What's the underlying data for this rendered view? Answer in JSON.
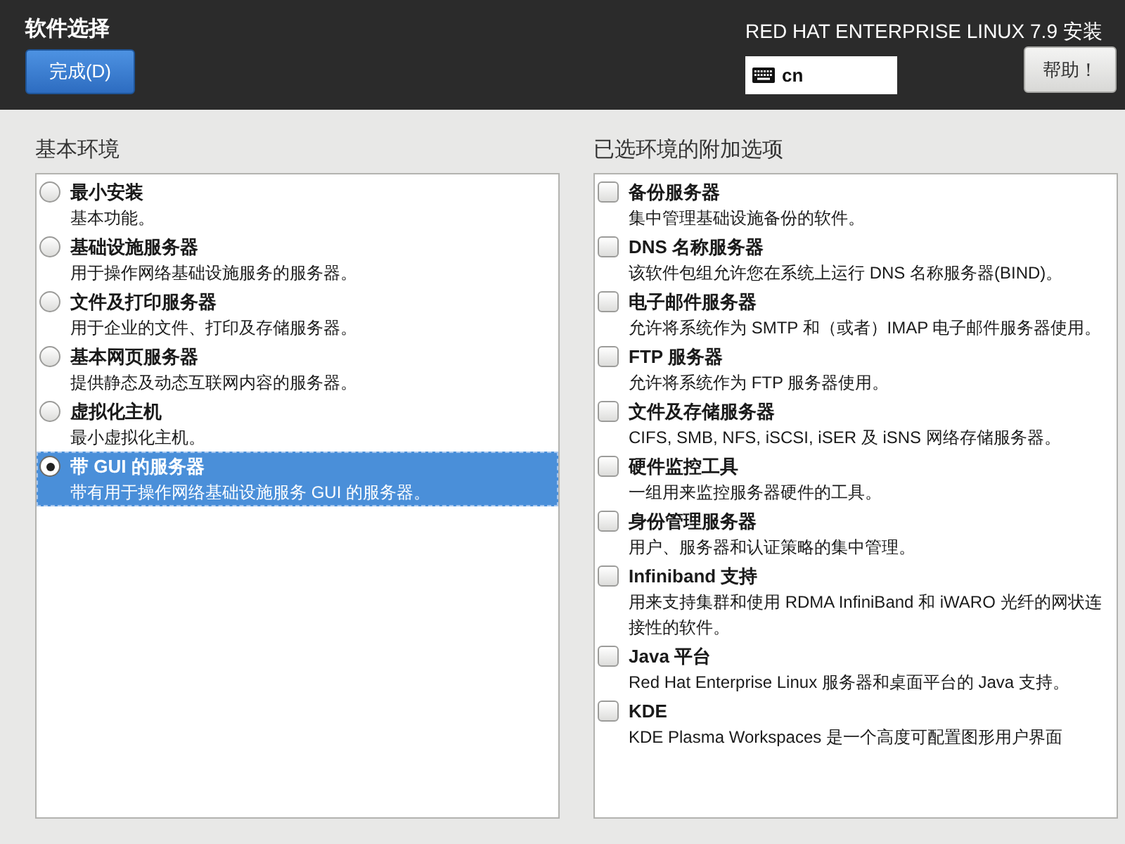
{
  "header": {
    "title": "软件选择",
    "done_button": "完成(D)",
    "product": "RED HAT ENTERPRISE LINUX 7.9 安装",
    "keyboard_layout": "cn",
    "help_button": "帮助！"
  },
  "base_environment": {
    "heading": "基本环境",
    "items": [
      {
        "title": "最小安装",
        "description": "基本功能。",
        "selected": false
      },
      {
        "title": "基础设施服务器",
        "description": "用于操作网络基础设施服务的服务器。",
        "selected": false
      },
      {
        "title": "文件及打印服务器",
        "description": "用于企业的文件、打印及存储服务器。",
        "selected": false
      },
      {
        "title": "基本网页服务器",
        "description": "提供静态及动态互联网内容的服务器。",
        "selected": false
      },
      {
        "title": "虚拟化主机",
        "description": "最小虚拟化主机。",
        "selected": false
      },
      {
        "title": "带 GUI 的服务器",
        "description": "带有用于操作网络基础设施服务 GUI 的服务器。",
        "selected": true
      }
    ]
  },
  "addons": {
    "heading": "已选环境的附加选项",
    "items": [
      {
        "title": "备份服务器",
        "description": "集中管理基础设施备份的软件。",
        "checked": false
      },
      {
        "title": "DNS 名称服务器",
        "description": "该软件包组允许您在系统上运行 DNS 名称服务器(BIND)。",
        "checked": false
      },
      {
        "title": "电子邮件服务器",
        "description": "允许将系统作为 SMTP 和（或者）IMAP 电子邮件服务器使用。",
        "checked": false
      },
      {
        "title": "FTP 服务器",
        "description": "允许将系统作为 FTP 服务器使用。",
        "checked": false
      },
      {
        "title": "文件及存储服务器",
        "description": "CIFS, SMB, NFS, iSCSI, iSER 及 iSNS 网络存储服务器。",
        "checked": false
      },
      {
        "title": "硬件监控工具",
        "description": "一组用来监控服务器硬件的工具。",
        "checked": false
      },
      {
        "title": "身份管理服务器",
        "description": "用户、服务器和认证策略的集中管理。",
        "checked": false
      },
      {
        "title": "Infiniband 支持",
        "description": "用来支持集群和使用 RDMA InfiniBand 和 iWARO 光纤的网状连接性的软件。",
        "checked": false
      },
      {
        "title": "Java 平台",
        "description": "Red Hat Enterprise Linux 服务器和桌面平台的 Java 支持。",
        "checked": false
      },
      {
        "title": "KDE",
        "description": "KDE Plasma Workspaces 是一个高度可配置图形用户界面",
        "checked": false
      }
    ]
  }
}
